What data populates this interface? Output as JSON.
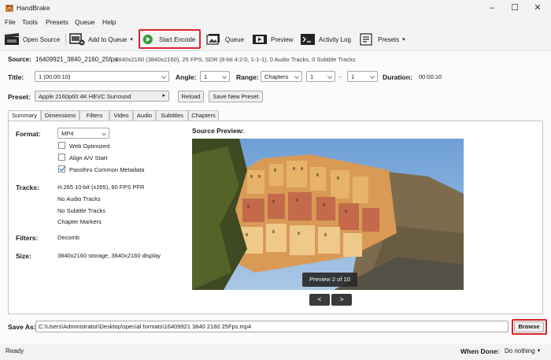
{
  "window": {
    "title": "HandBrake",
    "controls": [
      "–",
      "☐",
      "✕"
    ]
  },
  "menu": [
    "File",
    "Tools",
    "Presets",
    "Queue",
    "Help"
  ],
  "toolbar": {
    "open_source": "Open Source",
    "add_to_queue": "Add to Queue",
    "start_encode": "Start Encode",
    "queue": "Queue",
    "preview": "Preview",
    "activity_log": "Activity Log",
    "presets": "Presets"
  },
  "source": {
    "label": "Source:",
    "name": "16409921_3840_2160_25fps",
    "info": "3840x2160 (3840x2160), 25 FPS, SDR (8-bit 4:2:0, 1-1-1), 0 Audio Tracks, 0 Subtitle Tracks"
  },
  "title_row": {
    "title_label": "Title:",
    "title_value": "1  (00:00:10)",
    "angle_label": "Angle:",
    "angle_value": "1",
    "range_label": "Range:",
    "range_value": "Chapters",
    "range_start": "1",
    "range_dash": "-",
    "range_end": "1",
    "duration_label": "Duration:",
    "duration_value": "00:00:10"
  },
  "preset": {
    "label": "Preset:",
    "value": "Apple 2160p60 4K HEVC Surround",
    "reload": "Reload",
    "save_new": "Save New Preset"
  },
  "tabs": [
    "Summary",
    "Dimensions",
    "Filters",
    "Video",
    "Audio",
    "Subtitles",
    "Chapters"
  ],
  "summary": {
    "format_label": "Format:",
    "format_value": "MP4",
    "web_optimized": "Web Optimized",
    "web_optimized_checked": false,
    "align_av": "Align A/V Start",
    "align_av_checked": false,
    "passthru": "Passthru Common Metadata",
    "passthru_checked": true,
    "tracks_label": "Tracks:",
    "tracks": [
      "H.265 10-bit (x265), 60 FPS PFR",
      "No Audio Tracks",
      "No Subtitle Tracks",
      "Chapter Markers"
    ],
    "filters_label": "Filters:",
    "filters_value": "Decomb",
    "size_label": "Size:",
    "size_value": "3840x2160 storage, 3840x2160 display",
    "source_preview_label": "Source Preview:",
    "preview_badge": "Preview 2 of 10",
    "prev": "<",
    "next": ">"
  },
  "save": {
    "label": "Save As:",
    "path": "C:\\Users\\Administrator\\Desktop\\special formats\\16409921 3840 2160 25Fps.mp4",
    "browse": "Browse"
  },
  "status": {
    "text": "Ready",
    "when_done_label": "When Done:",
    "when_done_value": "Do nothing"
  },
  "colors": {
    "highlight": "#d9252a",
    "play_green": "#3a9b3e",
    "checkbox_accent": "#1a5fb4"
  }
}
